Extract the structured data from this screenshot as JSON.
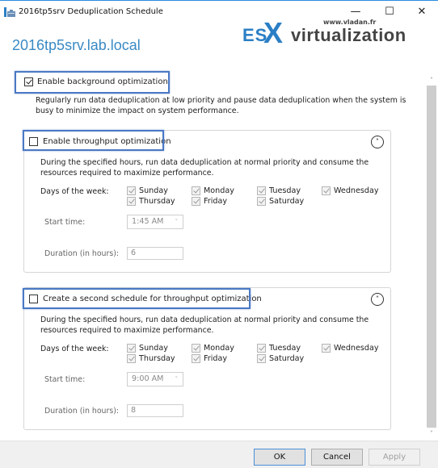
{
  "window": {
    "title": "2016tp5srv Deduplication Schedule",
    "controls": {
      "minimize": "—",
      "maximize": "☐",
      "close": "✕"
    }
  },
  "watermark": {
    "url": "www.vladan.fr",
    "es": "ES",
    "x": "X",
    "rest": "virtualization"
  },
  "server_name": "2016tp5srv.lab.local",
  "background_optimization": {
    "label": "Enable background optimization",
    "checked": true,
    "description": "Regularly run data deduplication at low priority and pause data deduplication when the system is busy to minimize the impact on system performance."
  },
  "schedules": [
    {
      "label": "Enable throughput optimization",
      "checked": false,
      "collapse_icon": "˄",
      "description": "During the specified hours, run data deduplication at normal priority and consume the resources required to maximize performance.",
      "days_label": "Days of the week:",
      "days": [
        {
          "name": "Sunday",
          "checked": true
        },
        {
          "name": "Monday",
          "checked": true
        },
        {
          "name": "Tuesday",
          "checked": true
        },
        {
          "name": "Wednesday",
          "checked": true
        },
        {
          "name": "Thursday",
          "checked": true
        },
        {
          "name": "Friday",
          "checked": true
        },
        {
          "name": "Saturday",
          "checked": true
        }
      ],
      "start_time_label": "Start time:",
      "start_time": "1:45 AM",
      "duration_label": "Duration (in hours):",
      "duration": "6"
    },
    {
      "label": "Create a second schedule for throughput optimization",
      "checked": false,
      "collapse_icon": "˄",
      "description": "During the specified hours, run data deduplication at normal priority and consume the resources required to maximize performance.",
      "days_label": "Days of the week:",
      "days": [
        {
          "name": "Sunday",
          "checked": true
        },
        {
          "name": "Monday",
          "checked": true
        },
        {
          "name": "Tuesday",
          "checked": true
        },
        {
          "name": "Wednesday",
          "checked": true
        },
        {
          "name": "Thursday",
          "checked": true
        },
        {
          "name": "Friday",
          "checked": true
        },
        {
          "name": "Saturday",
          "checked": true
        }
      ],
      "start_time_label": "Start time:",
      "start_time": "9:00 AM",
      "duration_label": "Duration (in hours):",
      "duration": "8"
    }
  ],
  "scrollbar": {
    "up": "˄",
    "down": "˅"
  },
  "dropdown_arrow": "˅",
  "footer": {
    "ok": "OK",
    "cancel": "Cancel",
    "apply": "Apply"
  },
  "colors": {
    "highlight": "#4a78c4",
    "server_name": "#3a8ac4",
    "logo_blue": "#2a7fc5"
  }
}
